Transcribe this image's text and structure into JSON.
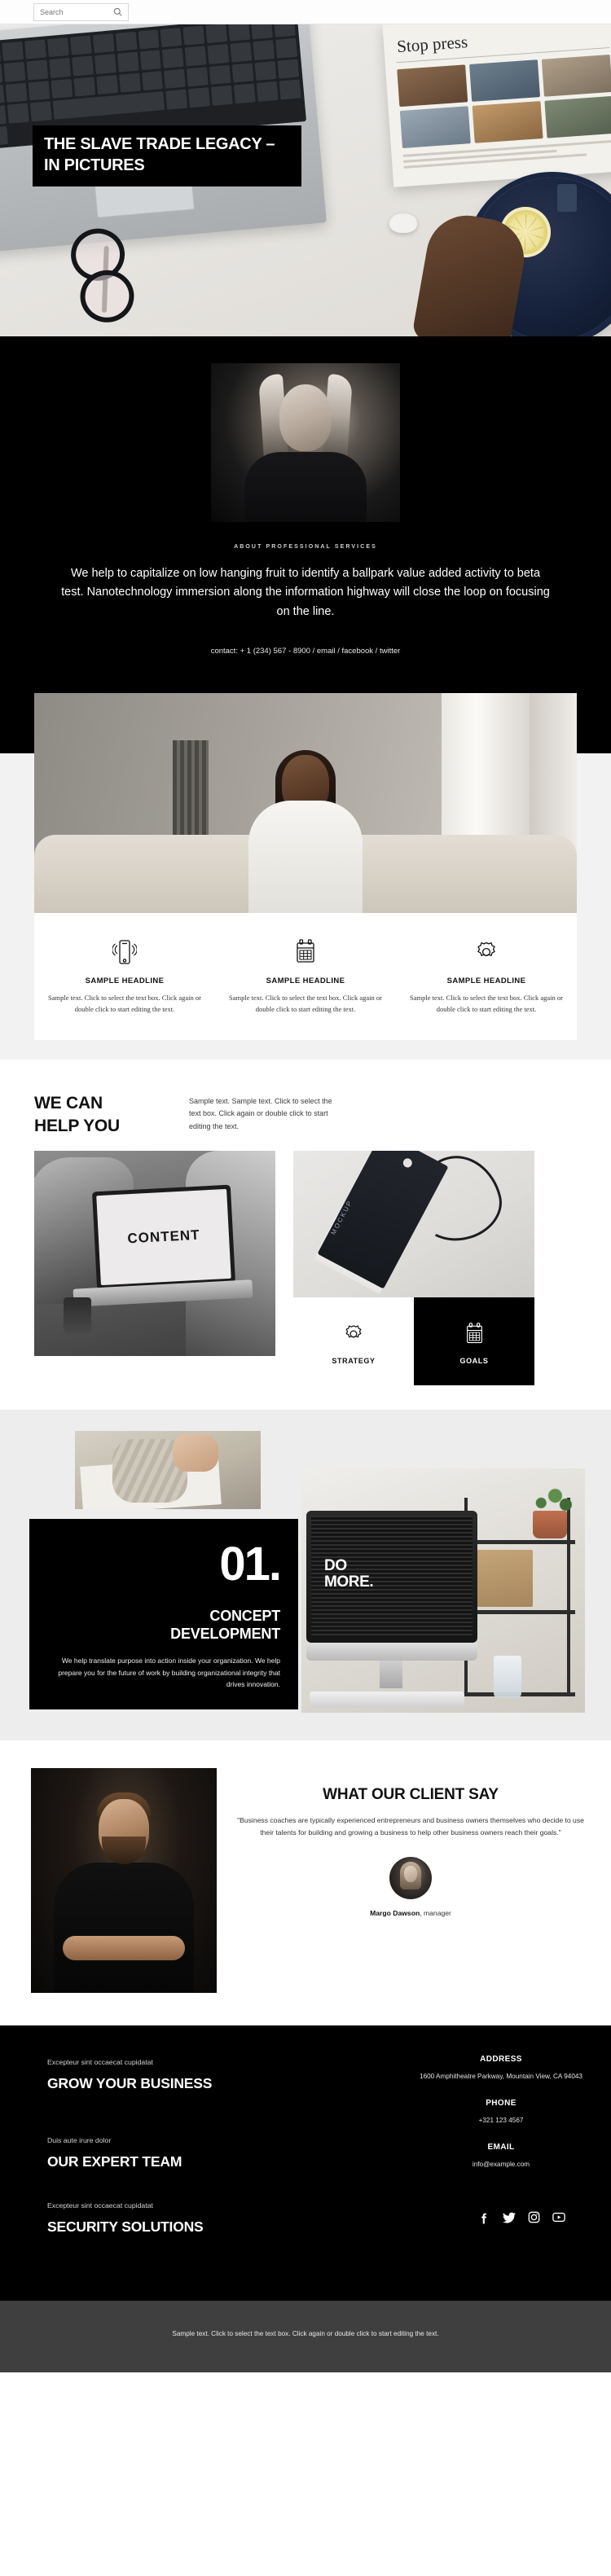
{
  "search": {
    "placeholder": "Search",
    "value": "",
    "icon": "search-icon"
  },
  "hero": {
    "title": "THE SLAVE TRADE LEGACY – IN PICTURES",
    "magazine_headline": "Stop press"
  },
  "about": {
    "kicker": "ABOUT PROFESSIONAL SERVICES",
    "body": "We help to capitalize on low hanging fruit to identify a ballpark value added activity to beta test. Nanotechnology immersion along the information highway will close the loop on focusing on the line.",
    "contact": "contact: + 1 (234) 567 - 8900 / email / facebook / twitter"
  },
  "features": [
    {
      "icon": "mobile-phone-icon",
      "title": "SAMPLE HEADLINE",
      "text": "Sample text. Click to select the text box. Click again or double click to start editing the text."
    },
    {
      "icon": "calendar-icon",
      "title": "SAMPLE HEADLINE",
      "text": "Sample text. Click to select the text box. Click again or double click to start editing the text."
    },
    {
      "icon": "gear-icon",
      "title": "SAMPLE HEADLINE",
      "text": "Sample text. Click to select the text box. Click again or double click to start editing the text."
    }
  ],
  "help": {
    "heading_line1": "WE CAN",
    "heading_line2": "HELP YOU",
    "text": "Sample text. Sample text. Click to select the text box. Click again or double click to start editing the text.",
    "laptop_screen_text": "CONTENT",
    "tag_label": "MOCKUP",
    "tiles": [
      {
        "icon": "gear-icon",
        "label": "STRATEGY"
      },
      {
        "icon": "calendar-icon",
        "label": "GOALS"
      }
    ]
  },
  "concept": {
    "number": "01.",
    "heading_line1": "CONCEPT",
    "heading_line2": "DEVELOPMENT",
    "text": "We help translate purpose into action inside your organization. We help prepare you for the future of work by building organizational integrity that drives innovation.",
    "monitor_text_line1": "DO",
    "monitor_text_line2": "MORE."
  },
  "testimonial": {
    "heading": "WHAT OUR CLIENT SAY",
    "quote": "\"Business coaches are typically experienced entrepreneurs and business owners themselves who decide to use their talents for building and growing a business to help other business owners reach their goals.\"",
    "author_name": "Margo Dawson",
    "author_role": ", manager"
  },
  "footer": {
    "blocks": [
      {
        "kicker": "Excepteur sint occaecat cupidatat",
        "title": "GROW YOUR BUSINESS"
      },
      {
        "kicker": "Duis aute irure dolor",
        "title": "OUR EXPERT TEAM"
      }
    ],
    "last_block": {
      "kicker": "Excepteur sint occaecat cupidatat",
      "title": "SECURITY SOLUTIONS"
    },
    "contact": [
      {
        "label": "ADDRESS",
        "value": "1600 Amphitheatre Parkway, Mountain View, CA 94043"
      },
      {
        "label": "PHONE",
        "value": "+321 123 4567"
      },
      {
        "label": "EMAIL",
        "value": "info@example.com"
      }
    ],
    "socials": [
      {
        "name": "facebook-icon",
        "label": "f"
      },
      {
        "name": "twitter-icon",
        "label": "t"
      },
      {
        "name": "instagram-icon",
        "label": "i"
      },
      {
        "name": "youtube-icon",
        "label": "y"
      }
    ],
    "bottom_text": "Sample text. Click to select the text box. Click again or double click to start editing the text."
  }
}
